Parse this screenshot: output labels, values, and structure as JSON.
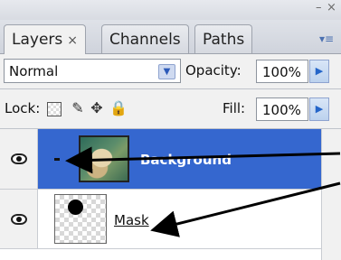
{
  "window": {
    "minimize_glyph": "–",
    "close_glyph": "×"
  },
  "tabs": [
    {
      "label": "Layers",
      "close": "×",
      "active": true
    },
    {
      "label": "Channels",
      "active": false
    },
    {
      "label": "Paths",
      "active": false
    }
  ],
  "panel_menu_icon": "panel-menu-icon",
  "blend": {
    "mode": "Normal",
    "opacity_label": "Opacity:",
    "opacity_value": "100%"
  },
  "lock": {
    "label": "Lock:",
    "icons": [
      "lock-transparent-icon",
      "lock-paint-icon",
      "lock-move-icon",
      "lock-all-icon"
    ],
    "fill_label": "Fill:",
    "fill_value": "100%"
  },
  "layers": [
    {
      "name": "Background",
      "selected": true,
      "visible": true,
      "thumb": "photo"
    },
    {
      "name": "Mask",
      "selected": false,
      "visible": true,
      "thumb": "mask"
    }
  ],
  "colors": {
    "selection": "#3567cf",
    "accent": "#2465c9"
  }
}
